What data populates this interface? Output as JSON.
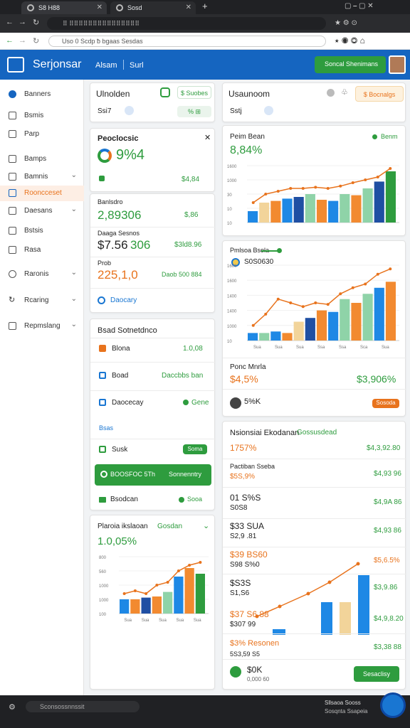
{
  "browser": {
    "tab1": "S8 H88",
    "tab2": "Sosd",
    "url": "⠿ ⠿⠿⠿⠿⠿⠿⠿⠿⠿⠿⠿⠿⠿⠿⠿",
    "page_url": "Uso 0 Scdp ƀ bgaas Sesdas",
    "plus": "+"
  },
  "header": {
    "brand": "Serjonsar",
    "nav": [
      "Alsam",
      "Surl"
    ],
    "button": "Soncal Shenimans"
  },
  "sidebar": {
    "items": [
      "Banners",
      "Bsmis",
      "Parp",
      "Bamps",
      "Bamnis",
      "Rooncceset",
      "Daesans",
      "Bstsis",
      "Rasa",
      "Raronis",
      "Rcaring",
      "Repmslang"
    ]
  },
  "summary": {
    "left_title": "Ulnolden",
    "left_value": "Ssi7",
    "left_btn": "$ Suobes",
    "left_sub": "% ⊞",
    "right_title": "Usaunoom",
    "right_value": "Sstj",
    "right_btn": "$ Bocnalgs"
  },
  "kpi1": {
    "title": "Peoclocsic",
    "value": "9%4",
    "footer_value": "$4,84"
  },
  "kpi2": {
    "title": "Banlsdro",
    "value": "2,89306",
    "right": "$,86"
  },
  "kpi3": {
    "title": "Daaga Sesnos",
    "value": "$7.56",
    "value2": "306",
    "right": "$3ld8.96"
  },
  "kpi4": {
    "title": "Prob",
    "value": "225,1,0",
    "right": "Daob 500 884"
  },
  "kpi_link": "Daocary",
  "chart1": {
    "title": "Peim Bean",
    "legend": "Benm",
    "value": "8,84%",
    "yticks": [
      "1600",
      "1000",
      "30",
      "10",
      "10"
    ]
  },
  "chart2": {
    "header": "Pmlsoa  Bsola",
    "legend": "S0S0630",
    "yticks": [
      "1600",
      "1600",
      "1400",
      "1400",
      "1000",
      "10"
    ],
    "xticks": [
      "Sua",
      "Sua",
      "Sua",
      "Ssa",
      "Ssa",
      "Sca",
      "Sua"
    ]
  },
  "chart2_footer": {
    "label": "Ponc Mnrla",
    "value1": "$4,5%",
    "value2": "$3,906%",
    "avatar_label": "5%K",
    "btn": "Sosoda"
  },
  "list_card": {
    "title": "Bsad Sotnetdnco",
    "rows": [
      {
        "label": "Blona",
        "right": "1.0,08"
      },
      {
        "label": "Boad",
        "right": "Daccbbs ban"
      },
      {
        "label": "Daocecay",
        "right": "Gene"
      },
      {
        "label": "Bsas",
        "right": ""
      },
      {
        "label": "Susk",
        "right": "Soma"
      },
      {
        "label": "BOOSFOC 5Th",
        "right": "Sonnenntry"
      },
      {
        "label": "Bsodcan",
        "right": "Sooa"
      }
    ]
  },
  "chart3": {
    "title": "Plaroia ikslaoan",
    "title_suffix": "Gosdan",
    "value": "1.0,05%",
    "yticks": [
      "800",
      "560",
      "1000",
      "1000",
      "100"
    ],
    "xticks": [
      "Sua",
      "Sua",
      "Sua",
      "Sua",
      "Sua"
    ]
  },
  "stats": {
    "title": "Nsionsiai Ekodanan",
    "title_suffix": "Gossusdead",
    "rows": [
      {
        "left": "1757%",
        "right": "$4,3,92.80"
      },
      {
        "left": "Pactiban Sseba",
        "left2": "$5S,9%",
        "right": "$4,93 96"
      },
      {
        "left": "01 S%S",
        "left2": "S0S8",
        "right": "$4,9A 86"
      },
      {
        "left": "$33 SUA",
        "left2": "S2,9 .81",
        "right": "$4,93 86"
      },
      {
        "left": "$39 BS60",
        "left2": "S98 S%0",
        "right": "$5,6.5%"
      },
      {
        "left": "$S3S",
        "left2": "S1,S6",
        "right": "$3,9.86"
      },
      {
        "left": "$37 S6 88",
        "left2": "$307 99",
        "right": "$4,9,8.20"
      },
      {
        "left": "$3% Resonen",
        "left2": "5S3,59 S5",
        "right": "$3,38 88"
      }
    ],
    "bottom_value": "$0K",
    "bottom_sub": "0,000 60",
    "bottom_btn": "Sesaclisy"
  },
  "statusbar": {
    "text": "Sconsossnnssit",
    "right": "Sllsaoa Sooss",
    "right2": "Sosqnta Ssapeia"
  },
  "colors": {
    "primary": "#1565c0",
    "green": "#2e9c3e",
    "orange": "#e8731d",
    "bar_blue": "#1e88e5",
    "bar_lightgreen": "#8fd3a8",
    "bar_tan": "#f2d49a",
    "bar_darkblue": "#1f4fa3",
    "bar_orange": "#f28a30"
  }
}
